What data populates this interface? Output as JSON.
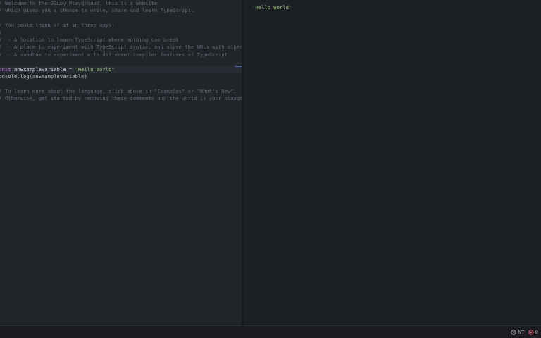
{
  "editor": {
    "lines": [
      {
        "type": "comment",
        "text": "// Welcome to the JSLoy Playground, this is a website"
      },
      {
        "type": "comment",
        "text": "// which gives you a chance to write, share and learn TypeScript."
      },
      {
        "type": "blank",
        "text": ""
      },
      {
        "type": "comment",
        "text": "// You could think of it in three ways:"
      },
      {
        "type": "comment",
        "text": "//"
      },
      {
        "type": "comment",
        "text": "//  - A location to learn TypeScript where nothing can break"
      },
      {
        "type": "comment",
        "text": "//  - A place to experiment with TypeScript syntax, and share the URLs with others"
      },
      {
        "type": "comment",
        "text": "//  - A sandbox to experiment with different compiler features of TypeScript"
      },
      {
        "type": "blank",
        "text": ""
      },
      {
        "type": "declaration",
        "keyword": "const",
        "name": " anExampleVariable",
        "op": " = ",
        "value": "\"Hello World\""
      },
      {
        "type": "plain",
        "text": "console.log(anExampleVariable)"
      },
      {
        "type": "blank",
        "text": ""
      },
      {
        "type": "comment",
        "text": "// To learn more about the language, click above in \"Examples\" or \"What's New\"."
      },
      {
        "type": "comment",
        "text": "// Otherwise, get started by removing these comments and the world is your playground."
      }
    ]
  },
  "output": {
    "log": "'Hello World'"
  },
  "statusbar": {
    "clock_icon": "clock-icon",
    "clock_label": "NT",
    "error_icon": "error-icon",
    "error_count": "0"
  },
  "colors": {
    "comment": "#626a76",
    "keyword": "#c678dd",
    "string": "#98c379",
    "accent": "#3f6fb5"
  }
}
